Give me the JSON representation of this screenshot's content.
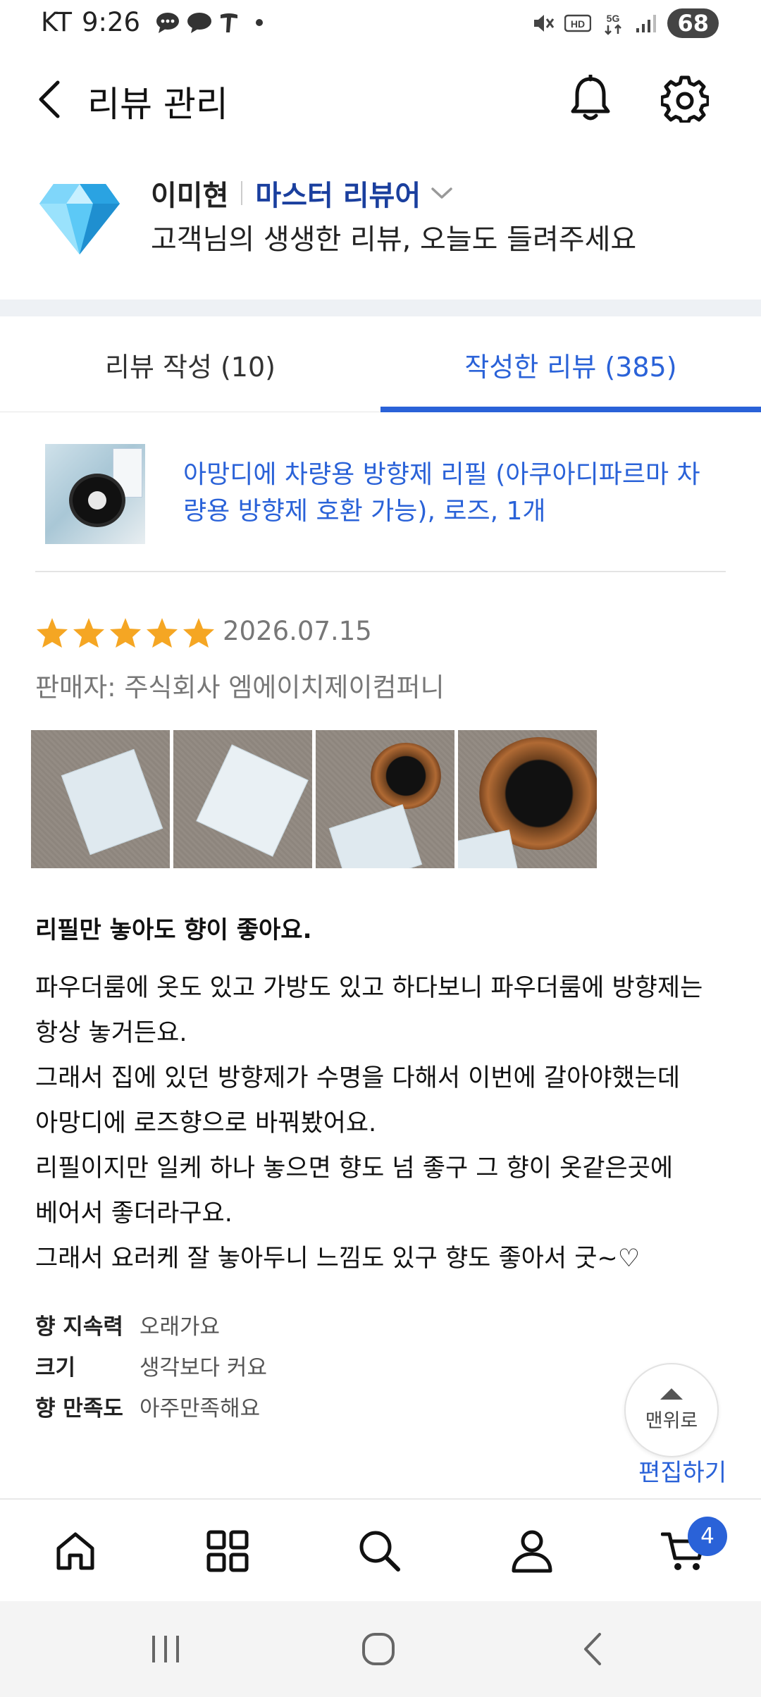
{
  "status_bar": {
    "carrier": "KT",
    "time": "9:26",
    "network": "5G",
    "battery": "68"
  },
  "header": {
    "title": "리뷰 관리"
  },
  "profile": {
    "name": "이미현",
    "grade": "마스터 리뷰어",
    "subtitle": "고객님의 생생한 리뷰, 오늘도 들려주세요"
  },
  "tabs": [
    {
      "label": "리뷰 작성 (10)",
      "active": false
    },
    {
      "label": "작성한 리뷰 (385)",
      "active": true
    }
  ],
  "review": {
    "product_title": "아망디에 차량용 방향제 리필 (아쿠아디파르마 차량용 방향제 호환 가능), 로즈, 1개",
    "rating": 5,
    "date": "2026.07.15",
    "seller": "판매자: 주식회사 엠에이치제이컴퍼니",
    "photo_count": 4,
    "title": "리필만 놓아도 향이 좋아요.",
    "body_lines": [
      "파우더룸에 옷도 있고 가방도 있고 하다보니 파우더룸에 방향제는",
      "항상 놓거든요.",
      "그래서 집에 있던 방향제가 수명을 다해서 이번에 갈아야했는데",
      "아망디에 로즈향으로 바꿔봤어요.",
      "리필이지만 일케 하나 놓으면 향도 넘 좋구 그 향이 옷같은곳에",
      "베어서 좋더라구요.",
      "그래서 요러케 잘 놓아두니 느낌도 있구 향도 좋아서 굿~♡"
    ],
    "attributes": [
      {
        "key": "향 지속력",
        "value": "오래가요"
      },
      {
        "key": "크기",
        "value": "생각보다 커요"
      },
      {
        "key": "향 만족도",
        "value": "아주만족해요"
      }
    ],
    "edit_label": "편집하기"
  },
  "scroll_top_label": "맨위로",
  "bottom_nav": {
    "items": [
      "home-icon",
      "category-icon",
      "search-icon",
      "user-icon",
      "cart-icon"
    ],
    "cart_badge": "4"
  },
  "colors": {
    "accent": "#2a62d8",
    "grade": "#1a3f9e",
    "star": "#f5a623"
  }
}
